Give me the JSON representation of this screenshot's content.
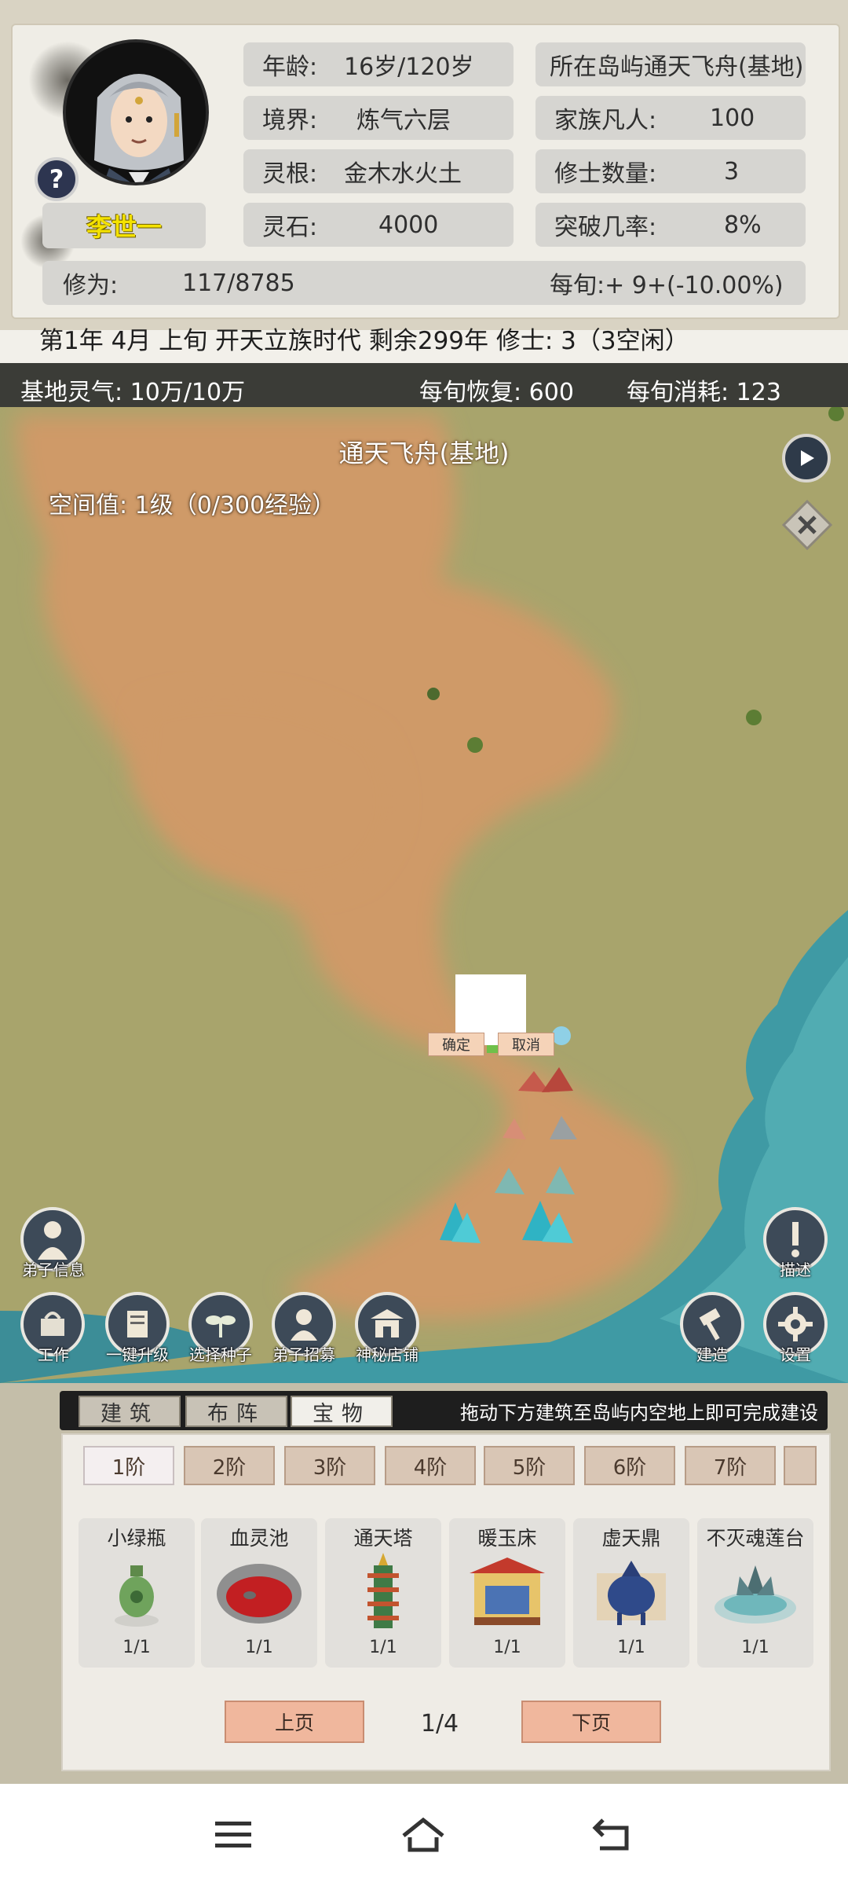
{
  "player": {
    "name": "李世一",
    "age_label": "年龄:",
    "age_value": "16岁/120岁",
    "realm_label": "境界:",
    "realm_value": "炼气六层",
    "root_label": "灵根:",
    "root_value": "金木水火土",
    "stones_label": "灵石:",
    "stones_value": "4000",
    "island_label": "所在岛屿",
    "island_value": "通天飞舟(基地)",
    "mortals_label": "家族凡人:",
    "mortals_value": "100",
    "cultivators_label": "修士数量:",
    "cultivators_value": "3",
    "breakthrough_label": "突破几率:",
    "breakthrough_value": "8%",
    "cultivation_label": "修为:",
    "cultivation_value": "117/8785",
    "per_xun_value": "每旬:+ 9+(-10.00%)"
  },
  "status_line": "第1年 4月 上旬  开天立族时代 剩余299年 修士: 3（3空闲）",
  "resource_bar": {
    "qi": "基地灵气: 10万/10万",
    "recovery": "每旬恢复: 600",
    "consumption": "每旬消耗: 123"
  },
  "map": {
    "title": "通天飞舟(基地)",
    "space_value": "空间值: 1级（0/300经验）",
    "confirm_label": "确定",
    "cancel_label": "取消"
  },
  "bottom_buttons": {
    "disciple_info": "弟子信息",
    "work": "工作",
    "one_click_upgrade": "一键升级",
    "select_seeds": "选择种子",
    "recruit_disciples": "弟子招募",
    "mystery_shop": "神秘店铺",
    "describe": "描述",
    "build": "建造",
    "settings": "设置"
  },
  "build_panel": {
    "tabs": [
      "建筑",
      "布阵",
      "宝物"
    ],
    "hint": "拖动下方建筑至岛屿内空地上即可完成建设",
    "tiers": [
      "1阶",
      "2阶",
      "3阶",
      "4阶",
      "5阶",
      "6阶",
      "7阶"
    ],
    "items": [
      {
        "name": "小绿瓶",
        "count": "1/1"
      },
      {
        "name": "血灵池",
        "count": "1/1"
      },
      {
        "name": "通天塔",
        "count": "1/1"
      },
      {
        "name": "暖玉床",
        "count": "1/1"
      },
      {
        "name": "虚天鼎",
        "count": "1/1"
      },
      {
        "name": "不灭魂莲台",
        "count": "1/1"
      }
    ],
    "prev_page": "上页",
    "page_indicator": "1/4",
    "next_page": "下页"
  },
  "icons": {
    "help": "question-icon",
    "play": "play-icon",
    "close": "close-icon",
    "menu": "menu-icon",
    "home": "home-icon",
    "back": "back-icon"
  }
}
